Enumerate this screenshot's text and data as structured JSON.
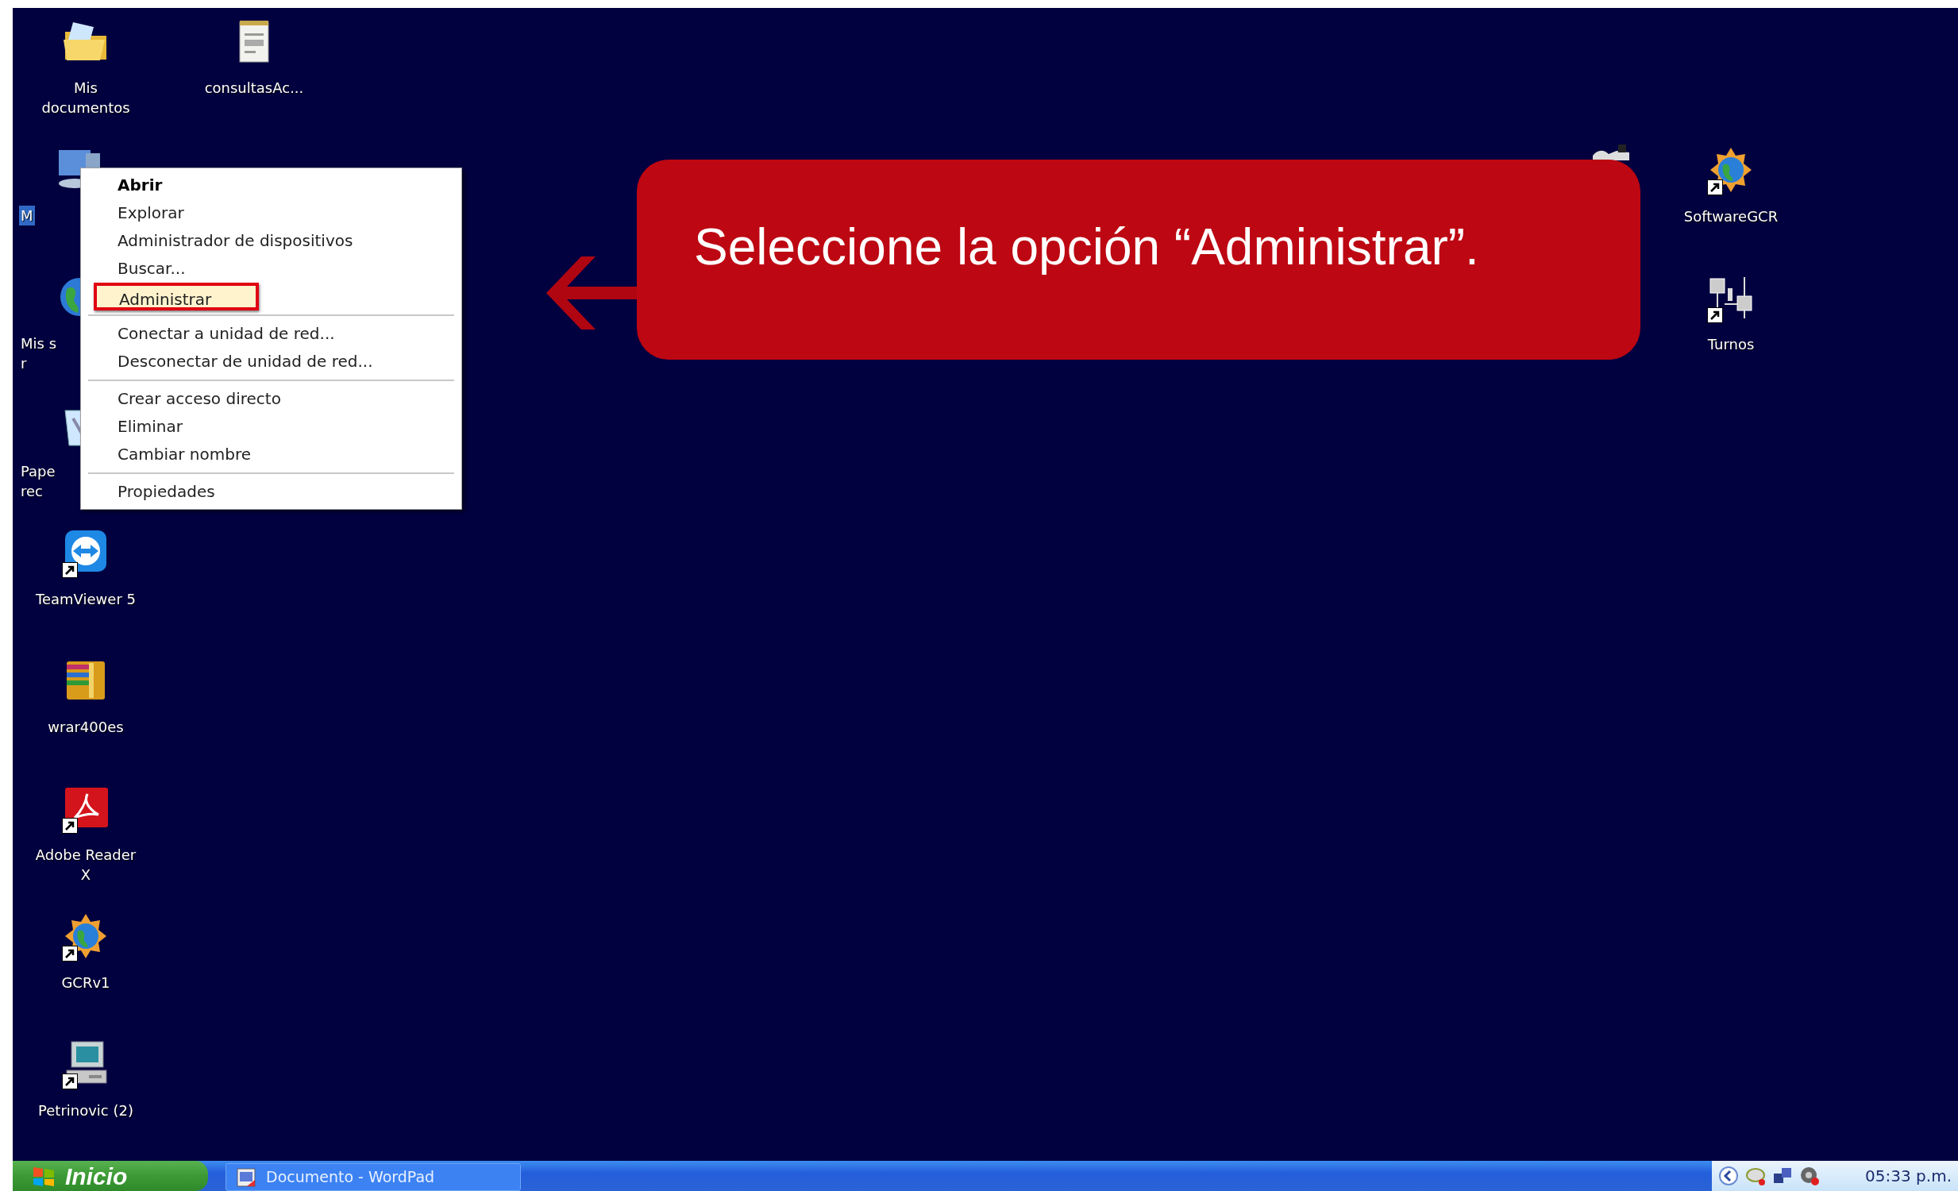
{
  "desktop": {
    "icons_left": [
      {
        "kind": "folder",
        "lines": [
          "Mis",
          "documentos"
        ],
        "selected": false,
        "covered": false
      },
      {
        "kind": "computer",
        "lines": [
          "M"
        ],
        "selected": true,
        "covered": true
      },
      {
        "kind": "globe",
        "lines": [
          "Mis s",
          "r"
        ],
        "selected": false,
        "covered": true
      },
      {
        "kind": "recycle",
        "lines": [
          "Pape",
          "rec"
        ],
        "selected": false,
        "covered": true
      },
      {
        "kind": "teamviewer",
        "lines": [
          "TeamViewer 5"
        ],
        "selected": false,
        "shortcut": true,
        "covered": false
      },
      {
        "kind": "archive",
        "lines": [
          "wrar400es"
        ],
        "selected": false,
        "covered": false
      },
      {
        "kind": "pdf",
        "lines": [
          "Adobe Reader",
          "X"
        ],
        "selected": false,
        "shortcut": true,
        "covered": false
      },
      {
        "kind": "gcr",
        "lines": [
          "GCRv1"
        ],
        "selected": false,
        "shortcut": true,
        "covered": false
      },
      {
        "kind": "pc",
        "lines": [
          "Petrinovic (2)"
        ],
        "selected": false,
        "shortcut": true,
        "covered": false
      }
    ],
    "icons_top": [
      {
        "kind": "notepad",
        "lines": [
          "consultasAc..."
        ],
        "selected": false,
        "covered": false
      }
    ],
    "icons_right": [
      {
        "kind": "gcr",
        "lines": [
          "SoftwareGCR"
        ],
        "selected": false,
        "shortcut": true,
        "covered": false
      },
      {
        "kind": "network",
        "lines": [
          "Turnos"
        ],
        "selected": false,
        "shortcut": true,
        "covered": false
      }
    ],
    "icons_hidden": [
      {
        "kind": "machine",
        "selected": false,
        "covered": true
      }
    ]
  },
  "context_menu": {
    "sections": [
      {
        "items": [
          {
            "label": "Abrir",
            "default": true,
            "marked": false
          },
          {
            "label": "Explorar",
            "default": false,
            "marked": false
          },
          {
            "label": "Administrador de dispositivos",
            "default": false,
            "marked": false
          },
          {
            "label": "Buscar...",
            "default": false,
            "marked": false
          },
          {
            "label": "Administrar",
            "default": false,
            "marked": true
          }
        ]
      },
      {
        "items": [
          {
            "label": "Conectar a unidad de red...",
            "default": false,
            "marked": false
          },
          {
            "label": "Desconectar de unidad de red...",
            "default": false,
            "marked": false
          }
        ]
      },
      {
        "items": [
          {
            "label": "Crear acceso directo",
            "default": false,
            "marked": false
          },
          {
            "label": "Eliminar",
            "default": false,
            "marked": false
          },
          {
            "label": "Cambiar nombre",
            "default": false,
            "marked": false
          }
        ]
      },
      {
        "items": [
          {
            "label": "Propiedades",
            "default": false,
            "marked": false
          }
        ]
      }
    ]
  },
  "callout": {
    "text": "Seleccione la opción “Administrar”."
  },
  "taskbar": {
    "start_button": {
      "label": "Inicio"
    },
    "tasks": [
      {
        "label": "Documento - WordPad",
        "selected": false
      }
    ],
    "clock": "05:33 p.m."
  }
}
